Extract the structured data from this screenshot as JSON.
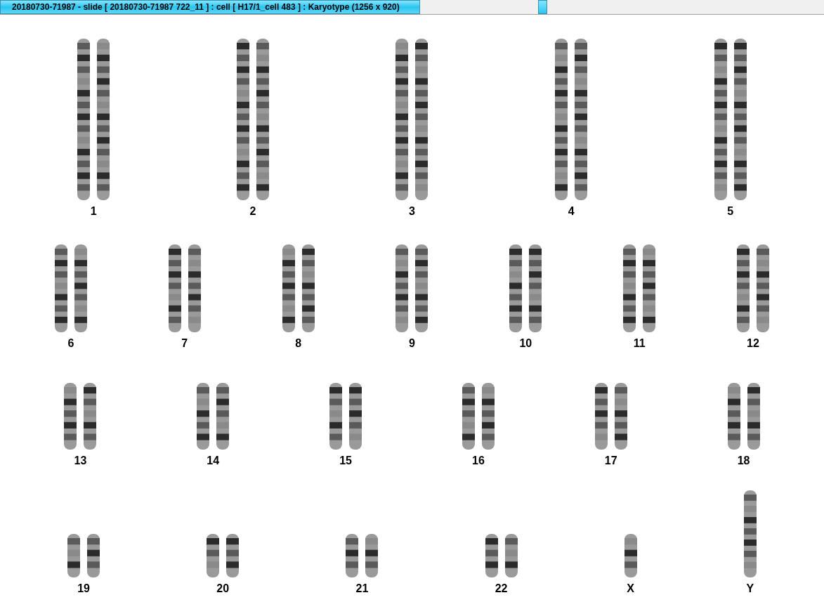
{
  "window": {
    "title": "20180730-71987 - slide [ 20180730-71987 722_11 ] : cell [ H17/1_cell 483 ] : Karyotype  (1256 x 920)"
  },
  "karyotype_rows": [
    {
      "chromosomes": [
        {
          "label": "1",
          "kind": "pair"
        },
        {
          "label": "2",
          "kind": "pair"
        },
        {
          "label": "3",
          "kind": "pair"
        },
        {
          "label": "4",
          "kind": "pair"
        },
        {
          "label": "5",
          "kind": "pair"
        }
      ]
    },
    {
      "chromosomes": [
        {
          "label": "6",
          "kind": "pair"
        },
        {
          "label": "7",
          "kind": "pair"
        },
        {
          "label": "8",
          "kind": "pair"
        },
        {
          "label": "9",
          "kind": "pair"
        },
        {
          "label": "10",
          "kind": "pair"
        },
        {
          "label": "11",
          "kind": "pair"
        },
        {
          "label": "12",
          "kind": "pair"
        }
      ]
    },
    {
      "chromosomes": [
        {
          "label": "13",
          "kind": "pair"
        },
        {
          "label": "14",
          "kind": "pair"
        },
        {
          "label": "15",
          "kind": "pair"
        },
        {
          "label": "16",
          "kind": "pair"
        },
        {
          "label": "17",
          "kind": "pair"
        },
        {
          "label": "18",
          "kind": "pair"
        }
      ]
    },
    {
      "chromosomes": [
        {
          "label": "19",
          "kind": "pair"
        },
        {
          "label": "20",
          "kind": "pair"
        },
        {
          "label": "21",
          "kind": "pair"
        },
        {
          "label": "22",
          "kind": "pair"
        },
        {
          "label": "X",
          "kind": "single"
        },
        {
          "label": "Y",
          "kind": "single"
        }
      ]
    }
  ]
}
